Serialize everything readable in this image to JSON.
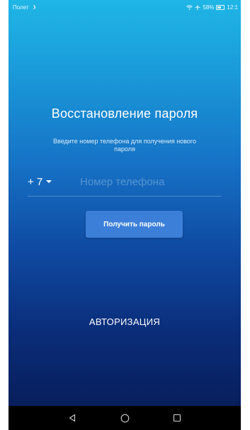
{
  "status_bar": {
    "airplane_label": "Полет",
    "battery_text": "58%",
    "time": "12:1"
  },
  "screen": {
    "title": "Восстановление пароля",
    "subtitle": "Введите номер телефона для получения нового пароля"
  },
  "phone_form": {
    "country_code": "+ 7",
    "phone_placeholder": "Номер телефона",
    "phone_value": ""
  },
  "buttons": {
    "get_password": "Получить пароль",
    "authorization": "АВТОРИЗАЦИЯ"
  },
  "colors": {
    "gradient_top": "#1fb6e6",
    "gradient_bottom": "#071a52",
    "button_bg": "#3b7fd9"
  },
  "icons": {
    "back": "back-triangle-icon",
    "home": "home-circle-icon",
    "recents": "recents-square-icon",
    "dropdown": "caret-down-icon"
  }
}
